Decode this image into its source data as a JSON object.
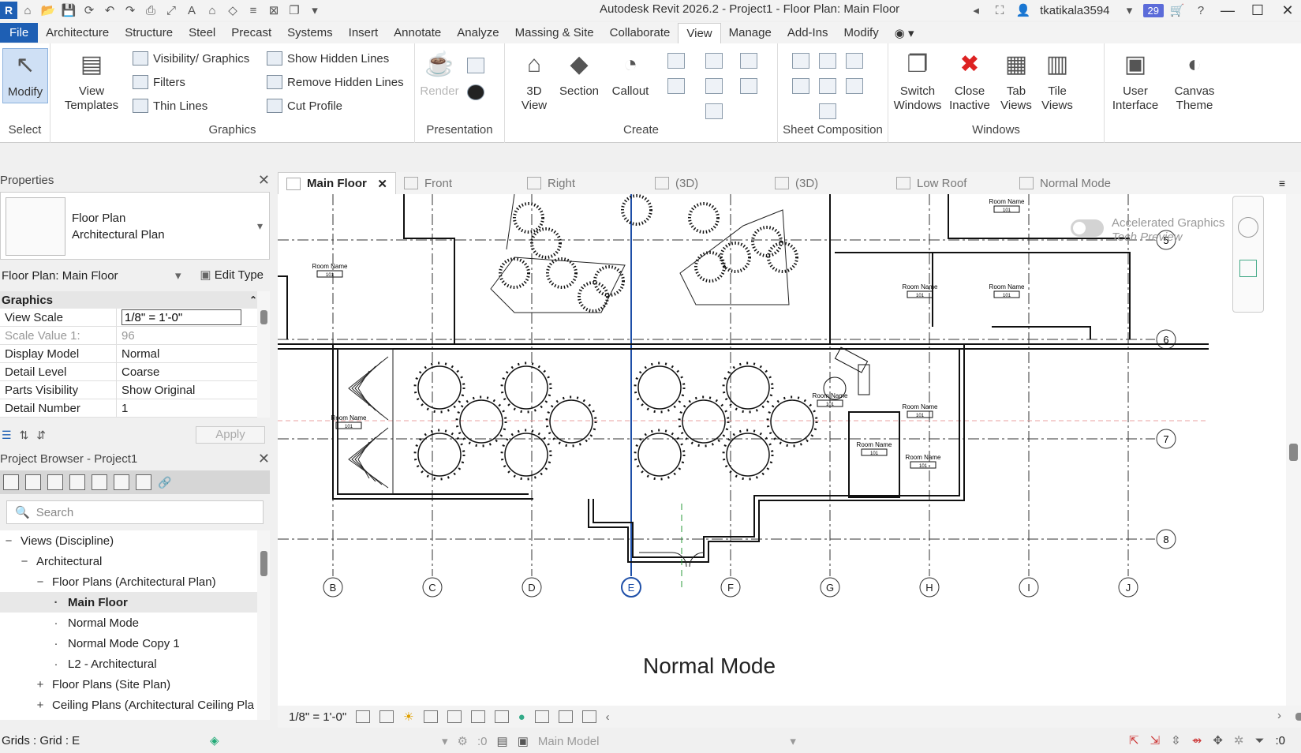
{
  "titlebar": {
    "app_letter": "R",
    "title": "Autodesk Revit 2026.2 - Project1 - Floor Plan: Main Floor",
    "user": "tkatikala3594",
    "notification_count": "29"
  },
  "menu": {
    "tabs": [
      "File",
      "Architecture",
      "Structure",
      "Steel",
      "Precast",
      "Systems",
      "Insert",
      "Annotate",
      "Analyze",
      "Massing & Site",
      "Collaborate",
      "View",
      "Manage",
      "Add-Ins",
      "Modify"
    ],
    "active_index": 11
  },
  "ribbon": {
    "select": {
      "modify_label": "Modify",
      "panel_title": "Select"
    },
    "graphics": {
      "view_templates": "View Templates",
      "visibility_graphics": "Visibility/ Graphics",
      "filters": "Filters",
      "thin_lines": "Thin Lines",
      "show_hidden_lines": "Show Hidden Lines",
      "remove_hidden_lines": "Remove Hidden Lines",
      "cut_profile": "Cut Profile",
      "panel_title": "Graphics"
    },
    "presentation": {
      "render": "Render",
      "panel_title": "Presentation"
    },
    "create": {
      "view_3d": "3D View",
      "section": "Section",
      "callout": "Callout",
      "panel_title": "Create"
    },
    "sheet_composition": {
      "panel_title": "Sheet Composition"
    },
    "windows": {
      "switch_windows": "Switch Windows",
      "close_inactive": "Close Inactive",
      "tab_views": "Tab Views",
      "tile_views": "Tile Views",
      "panel_title": "Windows"
    },
    "user_interface": "User Interface",
    "canvas_theme": "Canvas Theme"
  },
  "properties": {
    "title": "Properties",
    "type_line1": "Floor Plan",
    "type_line2": "Architectural Plan",
    "instance": "Floor Plan: Main Floor",
    "edit_type": "Edit Type",
    "category": "Graphics",
    "rows": [
      {
        "name": "View Scale",
        "value": "1/8\" = 1'-0\""
      },
      {
        "name": "Scale Value    1:",
        "value": "96"
      },
      {
        "name": "Display Model",
        "value": "Normal"
      },
      {
        "name": "Detail Level",
        "value": "Coarse"
      },
      {
        "name": "Parts Visibility",
        "value": "Show Original"
      },
      {
        "name": "Detail Number",
        "value": "1"
      }
    ],
    "apply": "Apply"
  },
  "browser": {
    "title": "Project Browser - Project1",
    "search_placeholder": "Search",
    "tree": [
      {
        "label": "Views (Discipline)",
        "level": 0,
        "exp": "−"
      },
      {
        "label": "Architectural",
        "level": 1,
        "exp": "−"
      },
      {
        "label": "Floor Plans (Architectural Plan)",
        "level": 2,
        "exp": "−"
      },
      {
        "label": "Main Floor",
        "level": 3,
        "exp": ""
      },
      {
        "label": "Normal Mode",
        "level": 3,
        "exp": ""
      },
      {
        "label": "Normal Mode Copy 1",
        "level": 3,
        "exp": ""
      },
      {
        "label": "L2 - Architectural",
        "level": 3,
        "exp": ""
      },
      {
        "label": "Floor Plans (Site Plan)",
        "level": 2,
        "exp": "+"
      },
      {
        "label": "Ceiling Plans (Architectural Ceiling Pla",
        "level": 2,
        "exp": "+"
      }
    ]
  },
  "view_tabs": [
    "Main Floor",
    "Front",
    "Right",
    "(3D)",
    "(3D)",
    "Low Roof",
    "Normal Mode"
  ],
  "canvas": {
    "view_label": "Normal Mode",
    "agt_line1": "Accelerated Graphics",
    "agt_line2": "Tech Preview",
    "room_label": "Room Name",
    "room_number": "101",
    "grid_cols": [
      "B",
      "C",
      "D",
      "E",
      "F",
      "G",
      "H",
      "I",
      "J"
    ],
    "grid_rows": [
      "5",
      "6",
      "7",
      "8"
    ],
    "selected_grid": "E"
  },
  "viewbar": {
    "scale": "1/8\" = 1'-0\""
  },
  "status": {
    "text": "Grids : Grid : E",
    "worksets": ":0",
    "model": "Main Model",
    "filter_count": ":0"
  }
}
